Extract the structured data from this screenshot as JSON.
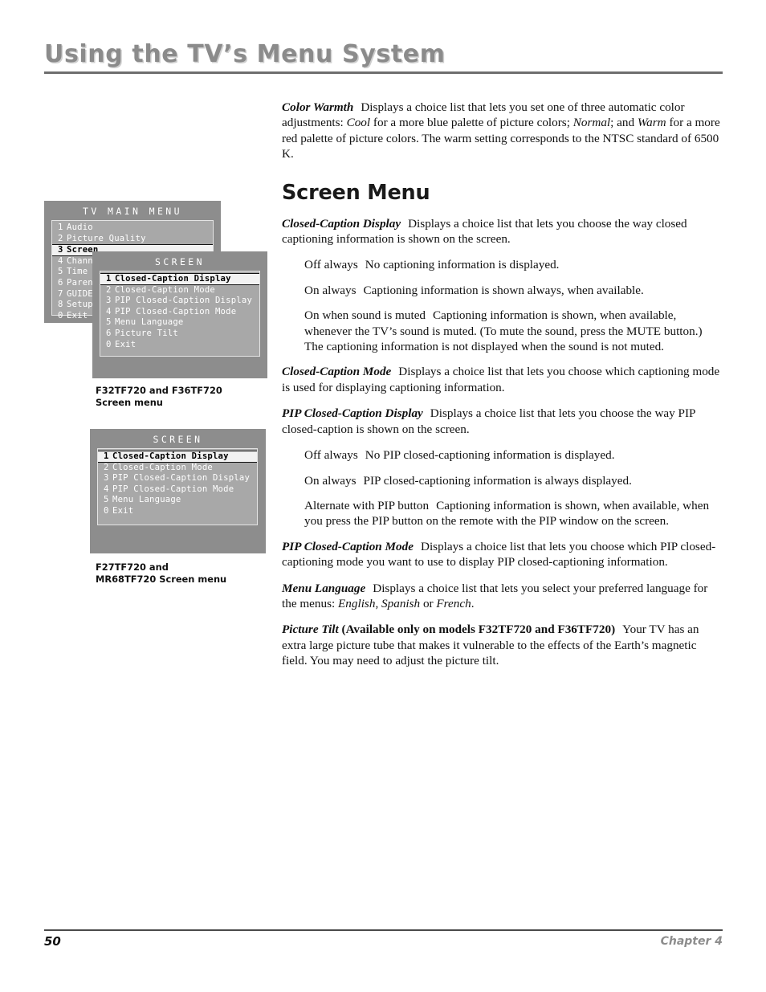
{
  "header": {
    "title": "Using the TV’s Menu System"
  },
  "body": {
    "color_warmth": {
      "lead": "Color Warmth",
      "text_1": "Displays a choice list that lets you set one of three automatic color adjustments: ",
      "ital_1": "Cool",
      "text_2": " for a more blue palette of picture colors; ",
      "ital_2": "Normal",
      "text_3": "; and ",
      "ital_3": "Warm",
      "text_4": " for a more red palette of picture colors. The warm setting corresponds to the NTSC standard of 6500 K."
    },
    "section_title": "Screen Menu",
    "cc_display": {
      "lead": "Closed-Caption Display",
      "text": "Displays a choice list that lets you choose the way closed captioning information is shown on the screen."
    },
    "cc_display_options": [
      {
        "lead": "Off always",
        "text": "No captioning information is displayed."
      },
      {
        "lead": "On always",
        "text": "Captioning information is shown always, when available."
      },
      {
        "lead": "On when sound is muted",
        "text": "Captioning information is shown, when available, whenever the TV’s sound is muted. (To mute the sound, press the MUTE button.) The captioning information is not displayed when the sound is not muted."
      }
    ],
    "cc_mode": {
      "lead": "Closed-Caption Mode",
      "text": "Displays a choice list that lets you choose which captioning mode is used for displaying captioning information."
    },
    "pip_cc_display": {
      "lead": "PIP Closed-Caption Display",
      "text": "Displays a choice list that lets you choose the way PIP closed-caption is shown on the screen."
    },
    "pip_cc_display_options": [
      {
        "lead": "Off always",
        "text": "No PIP closed-captioning information is displayed."
      },
      {
        "lead": "On always",
        "text": "PIP closed-captioning information is always displayed."
      },
      {
        "lead": "Alternate with PIP button",
        "text": "Captioning information is shown, when available, when you press the PIP button on the remote with the PIP window on the screen."
      }
    ],
    "pip_cc_mode": {
      "lead": "PIP Closed-Caption Mode",
      "text": "Displays a choice list that lets you choose which PIP closed-captioning mode you want to use to display PIP closed-captioning information."
    },
    "menu_language": {
      "lead": "Menu Language",
      "text_1": "Displays a choice list that lets you select your preferred language for the menus: ",
      "ital_1": "English",
      "text_2": ", ",
      "ital_2": "Spanish",
      "text_3": " or ",
      "ital_3": "French",
      "text_4": "."
    },
    "picture_tilt": {
      "lead": "Picture Tilt",
      "lead_plain": " (Available only on models F32TF720 and F36TF720)",
      "text": "Your TV has an extra large picture tube that makes it vulnerable to the effects of the Earth’s magnetic field. You may need to adjust the picture tilt."
    }
  },
  "figures": {
    "main_menu": {
      "title": "TV MAIN MENU",
      "items": [
        {
          "num": "1",
          "label": "Audio",
          "selected": false
        },
        {
          "num": "2",
          "label": "Picture Quality",
          "selected": false
        },
        {
          "num": "3",
          "label": "Screen",
          "selected": true
        },
        {
          "num": "4",
          "label": "Channel List",
          "selected": false
        },
        {
          "num": "5",
          "label": "Time",
          "selected": false
        },
        {
          "num": "6",
          "label": "Parental Controls",
          "selected": false
        },
        {
          "num": "7",
          "label": "GUIDE Plus+",
          "selected": false
        },
        {
          "num": "8",
          "label": "Setup",
          "selected": false
        },
        {
          "num": "0",
          "label": "Exit",
          "selected": false
        }
      ]
    },
    "screen_menu_a": {
      "title": "SCREEN",
      "items": [
        {
          "num": "1",
          "label": "Closed-Caption Display",
          "selected": true
        },
        {
          "num": "2",
          "label": "Closed-Caption Mode",
          "selected": false
        },
        {
          "num": "3",
          "label": "PIP Closed-Caption Display",
          "selected": false
        },
        {
          "num": "4",
          "label": "PIP Closed-Caption Mode",
          "selected": false
        },
        {
          "num": "5",
          "label": "Menu Language",
          "selected": false
        },
        {
          "num": "6",
          "label": "Picture Tilt",
          "selected": false
        },
        {
          "num": "0",
          "label": "Exit",
          "selected": false
        }
      ],
      "caption": "F32TF720 and F36TF720 Screen menu"
    },
    "screen_menu_b": {
      "title": "SCREEN",
      "items": [
        {
          "num": "1",
          "label": "Closed-Caption Display",
          "selected": true
        },
        {
          "num": "2",
          "label": "Closed-Caption Mode",
          "selected": false
        },
        {
          "num": "3",
          "label": "PIP Closed-Caption Display",
          "selected": false
        },
        {
          "num": "4",
          "label": "PIP Closed-Caption Mode",
          "selected": false
        },
        {
          "num": "5",
          "label": "Menu Language",
          "selected": false
        },
        {
          "num": "0",
          "label": "Exit",
          "selected": false
        }
      ],
      "caption": "F27TF720 and MR68TF720 Screen menu"
    }
  },
  "footer": {
    "page_number": "50",
    "chapter": "Chapter 4"
  },
  "colors": {
    "menu_background": "#8d8d8d",
    "menu_list_background": "#a8a8a8",
    "menu_selected_background": "#f2f2f2",
    "header_gray": "#8b8b8b",
    "rule_gray": "#6e6e6e"
  }
}
